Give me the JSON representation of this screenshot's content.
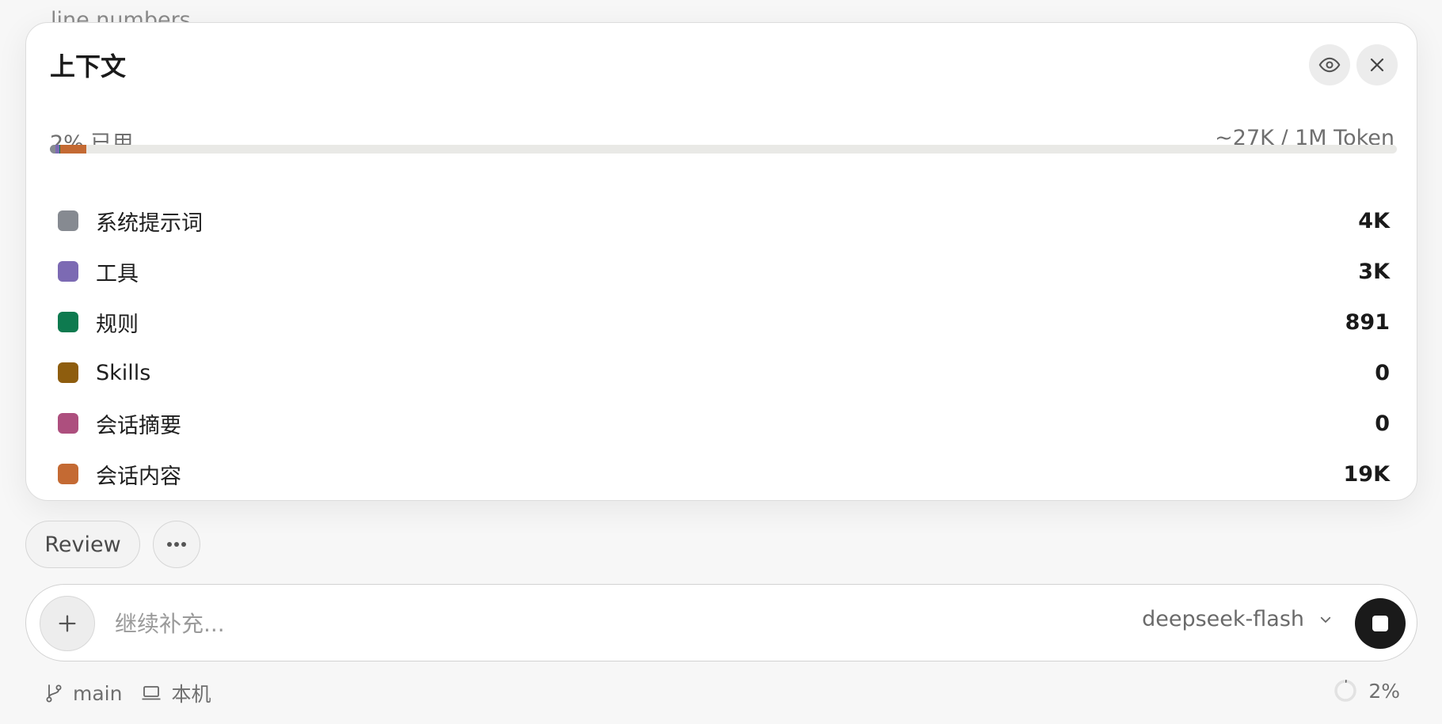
{
  "background": {
    "partial_text": "line numbers"
  },
  "context_panel": {
    "title": "上下文",
    "usage_text": "2% 已用",
    "tokens_text": "~27K / 1M Token",
    "usage_percent": 2,
    "items": [
      {
        "label": "系统提示词",
        "value": "4K",
        "color": "#868a91"
      },
      {
        "label": "工具",
        "value": "3K",
        "color": "#7c6ab3"
      },
      {
        "label": "规则",
        "value": "891",
        "color": "#0e7a4f"
      },
      {
        "label": "Skills",
        "value": "0",
        "color": "#8e5d0e"
      },
      {
        "label": "会话摘要",
        "value": "0",
        "color": "#ad4f7e"
      },
      {
        "label": "会话内容",
        "value": "19K",
        "color": "#c46a33"
      }
    ],
    "icons": {
      "preview": "eye-icon",
      "close": "close-icon"
    }
  },
  "actions": {
    "review_label": "Review",
    "more_icon": "ellipsis-icon"
  },
  "composer": {
    "input_value": "",
    "placeholder": "继续补充...",
    "model": "deepseek-flash",
    "add_icon": "plus-icon",
    "stop_icon": "stop-icon"
  },
  "status_bar": {
    "branch": "main",
    "location": "本机",
    "context_percent_text": "2%",
    "icons": {
      "branch": "git-branch-icon",
      "location": "laptop-icon",
      "context": "progress-ring-icon"
    }
  }
}
